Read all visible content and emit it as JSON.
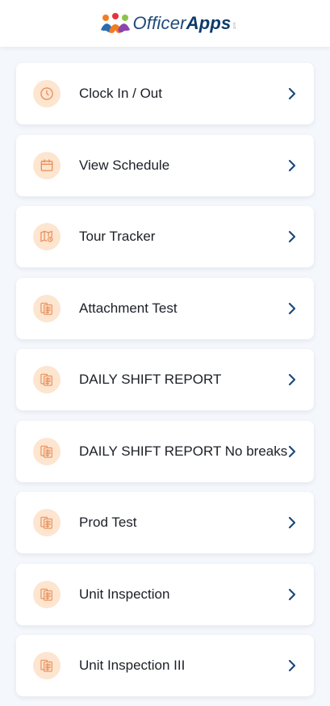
{
  "header": {
    "logo_text_light": "Officer",
    "logo_text_bold": "Apps",
    "logo_tm": "LLC"
  },
  "colors": {
    "icon_bg": "#fde5d0",
    "icon_stroke": "#e8905a",
    "chevron": "#1f4a7a",
    "text": "#1b1f26"
  },
  "menu": {
    "items": [
      {
        "label": "Clock In / Out",
        "icon": "clock-icon"
      },
      {
        "label": "View Schedule",
        "icon": "calendar-icon"
      },
      {
        "label": "Tour Tracker",
        "icon": "map-icon"
      },
      {
        "label": "Attachment Test",
        "icon": "form-icon"
      },
      {
        "label": "DAILY SHIFT REPORT",
        "icon": "form-icon"
      },
      {
        "label": "DAILY SHIFT REPORT No breaks",
        "icon": "form-icon"
      },
      {
        "label": "Prod Test",
        "icon": "form-icon"
      },
      {
        "label": "Unit Inspection",
        "icon": "form-icon"
      },
      {
        "label": "Unit Inspection III",
        "icon": "form-icon"
      }
    ]
  }
}
